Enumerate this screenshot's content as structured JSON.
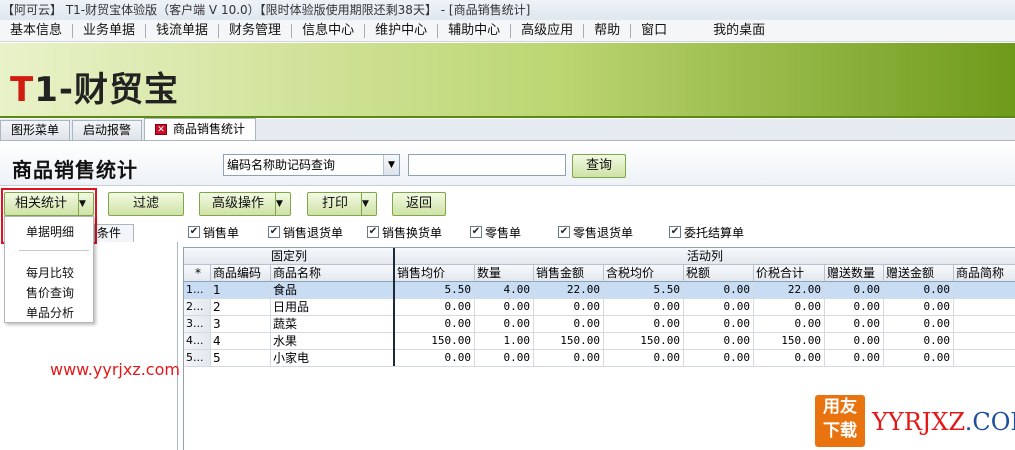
{
  "window": {
    "title": "【阿可云】 T1-财贸宝体验版（客户端 V 10.0）【限时体验版使用期限还剩38天】 - [商品销售统计]"
  },
  "menu": [
    "基本信息",
    "业务单据",
    "钱流单据",
    "财务管理",
    "信息中心",
    "维护中心",
    "辅助中心",
    "高级应用",
    "帮助",
    "窗口",
    "我的桌面"
  ],
  "banner": {
    "logo_t": "T",
    "logo_rest": "1-财贸宝"
  },
  "tabs": [
    "图形菜单",
    "启动报警",
    "商品销售统计"
  ],
  "page": {
    "title": "商品销售统计",
    "query_combo": "编码名称助记码查询",
    "query_input": "",
    "query_button": "查询"
  },
  "toolbar": {
    "related": "相关统计",
    "filter": "过滤",
    "advanced": "高级操作",
    "print": "打印",
    "back": "返回"
  },
  "dropdown": [
    "单据明细",
    "每月比较",
    "售价查询",
    "单品分析"
  ],
  "left_tab": "条件",
  "filters": [
    {
      "label": "销售单",
      "checked": true
    },
    {
      "label": "销售退货单",
      "checked": true
    },
    {
      "label": "销售换货单",
      "checked": true
    },
    {
      "label": "零售单",
      "checked": true
    },
    {
      "label": "零售退货单",
      "checked": true
    },
    {
      "label": "委托结算单",
      "checked": true
    }
  ],
  "grid": {
    "group_fixed": "固定列",
    "group_active": "活动列",
    "corner": "*",
    "columns": [
      "商品编码",
      "商品名称",
      "销售均价",
      "数量",
      "销售金额",
      "含税均价",
      "税额",
      "价税合计",
      "赠送数量",
      "赠送金额",
      "商品简称"
    ],
    "rows": [
      {
        "idx": "1...",
        "cells": [
          "1",
          "食品",
          "5.50",
          "4.00",
          "22.00",
          "5.50",
          "0.00",
          "22.00",
          "0.00",
          "0.00",
          ""
        ]
      },
      {
        "idx": "2...",
        "cells": [
          "2",
          "日用品",
          "0.00",
          "0.00",
          "0.00",
          "0.00",
          "0.00",
          "0.00",
          "0.00",
          "0.00",
          ""
        ]
      },
      {
        "idx": "3...",
        "cells": [
          "3",
          "蔬菜",
          "0.00",
          "0.00",
          "0.00",
          "0.00",
          "0.00",
          "0.00",
          "0.00",
          "0.00",
          ""
        ]
      },
      {
        "idx": "4...",
        "cells": [
          "4",
          "水果",
          "150.00",
          "1.00",
          "150.00",
          "150.00",
          "0.00",
          "150.00",
          "0.00",
          "0.00",
          ""
        ]
      },
      {
        "idx": "5...",
        "cells": [
          "5",
          "小家电",
          "0.00",
          "0.00",
          "0.00",
          "0.00",
          "0.00",
          "0.00",
          "0.00",
          "0.00",
          ""
        ]
      }
    ],
    "selected_row": 0
  },
  "watermarks": {
    "site": "www.yyrjxz.com",
    "logo_line1": "用友",
    "logo_line2": "下载",
    "brand_a": "YYRJXZ",
    "brand_b": ".COM"
  }
}
